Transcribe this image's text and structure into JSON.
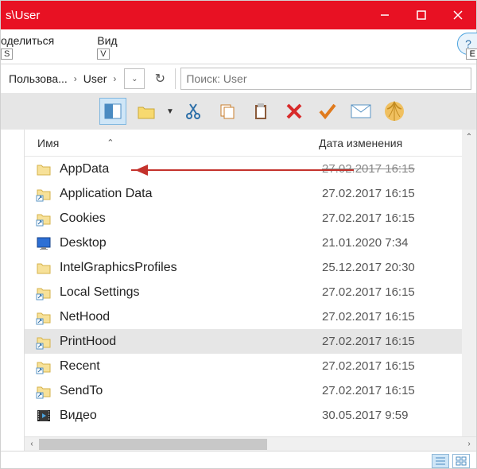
{
  "titlebar": {
    "title": "s\\User"
  },
  "ribbon": {
    "tabs": [
      {
        "label": "оделиться",
        "key": "S"
      },
      {
        "label": "Вид",
        "key": "V"
      }
    ],
    "help_key": "Е"
  },
  "breadcrumb": {
    "items": [
      "Пользова...",
      "User"
    ]
  },
  "search": {
    "placeholder": "Поиск: User"
  },
  "columns": {
    "name": "Имя",
    "date": "Дата изменения"
  },
  "rows": [
    {
      "icon": "folder",
      "name": "AppData",
      "date": "27.02.2017 16:15"
    },
    {
      "icon": "shortcut",
      "name": "Application Data",
      "date": "27.02.2017 16:15"
    },
    {
      "icon": "shortcut",
      "name": "Cookies",
      "date": "27.02.2017 16:15"
    },
    {
      "icon": "desktop",
      "name": "Desktop",
      "date": "21.01.2020 7:34"
    },
    {
      "icon": "folder",
      "name": "IntelGraphicsProfiles",
      "date": "25.12.2017 20:30"
    },
    {
      "icon": "shortcut",
      "name": "Local Settings",
      "date": "27.02.2017 16:15"
    },
    {
      "icon": "shortcut",
      "name": "NetHood",
      "date": "27.02.2017 16:15"
    },
    {
      "icon": "shortcut",
      "name": "PrintHood",
      "date": "27.02.2017 16:15",
      "selected": true
    },
    {
      "icon": "shortcut",
      "name": "Recent",
      "date": "27.02.2017 16:15"
    },
    {
      "icon": "shortcut",
      "name": "SendTo",
      "date": "27.02.2017 16:15"
    },
    {
      "icon": "video",
      "name": "Видео",
      "date": "30.05.2017 9:59"
    }
  ]
}
